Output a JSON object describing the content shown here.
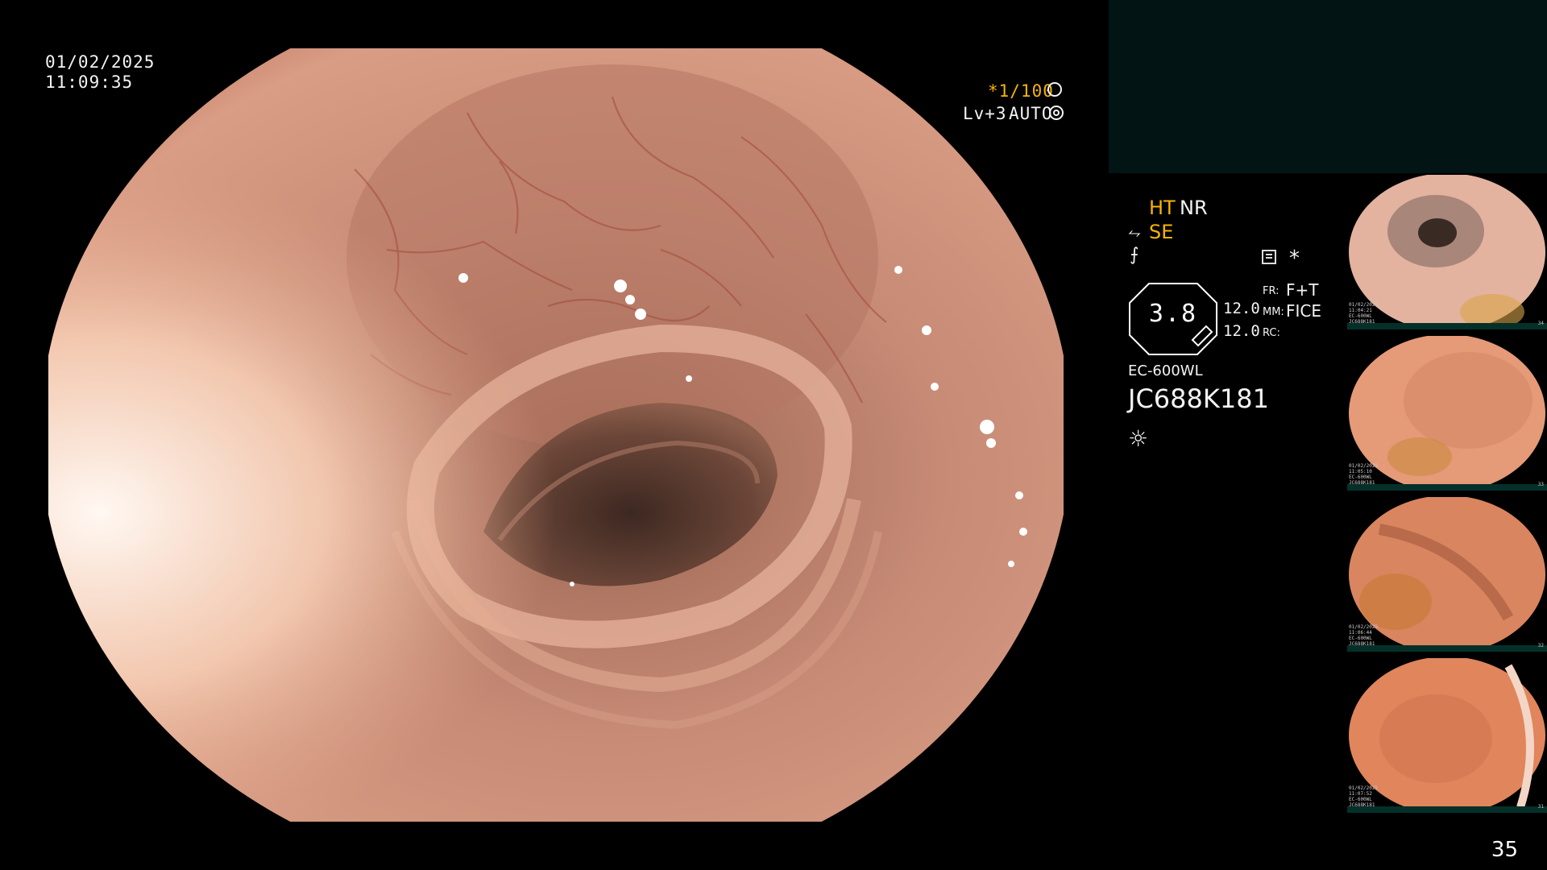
{
  "overlay": {
    "date": "01/02/2025",
    "time": "11:09:35",
    "shutter": "*1/100",
    "shutter_icon": "aperture-icon",
    "level": "Lv+3",
    "exposure_mode": "AUTO",
    "exposure_icon": "exposure-icon"
  },
  "status": {
    "ht": "HT",
    "nr": "NR",
    "se": "SE",
    "se_icon": "structure-enhance-icon",
    "curve_icon": "curve-icon",
    "record_icon": "record-icon",
    "star": "*",
    "zoom": "3.8",
    "fr_label": "FR:",
    "fr_value": "F+T",
    "mm_label": "MM:",
    "mm_value": "FICE",
    "rc_label": "RC:",
    "val_a": "12.0",
    "val_b": "12.0",
    "scope_model": "EC-600WL",
    "serial": "JC688K181",
    "light_icon": "light-source-icon"
  },
  "colors": {
    "amber": "#f7b400",
    "panel_teal": "#031414",
    "mucosa": "#c98a72"
  },
  "thumbnails": [
    {
      "meta": [
        "01/02/2025",
        "11:04:21",
        "EC-600WL",
        "JC688K181"
      ],
      "num": "34"
    },
    {
      "meta": [
        "01/02/2025",
        "11:05:10",
        "EC-600WL",
        "JC688K181"
      ],
      "num": "33"
    },
    {
      "meta": [
        "01/02/2025",
        "11:06:44",
        "EC-600WL",
        "JC688K181"
      ],
      "num": "32"
    },
    {
      "meta": [
        "01/02/2025",
        "11:07:52",
        "EC-600WL",
        "JC688K181"
      ],
      "num": "31"
    }
  ],
  "page_number": "35"
}
